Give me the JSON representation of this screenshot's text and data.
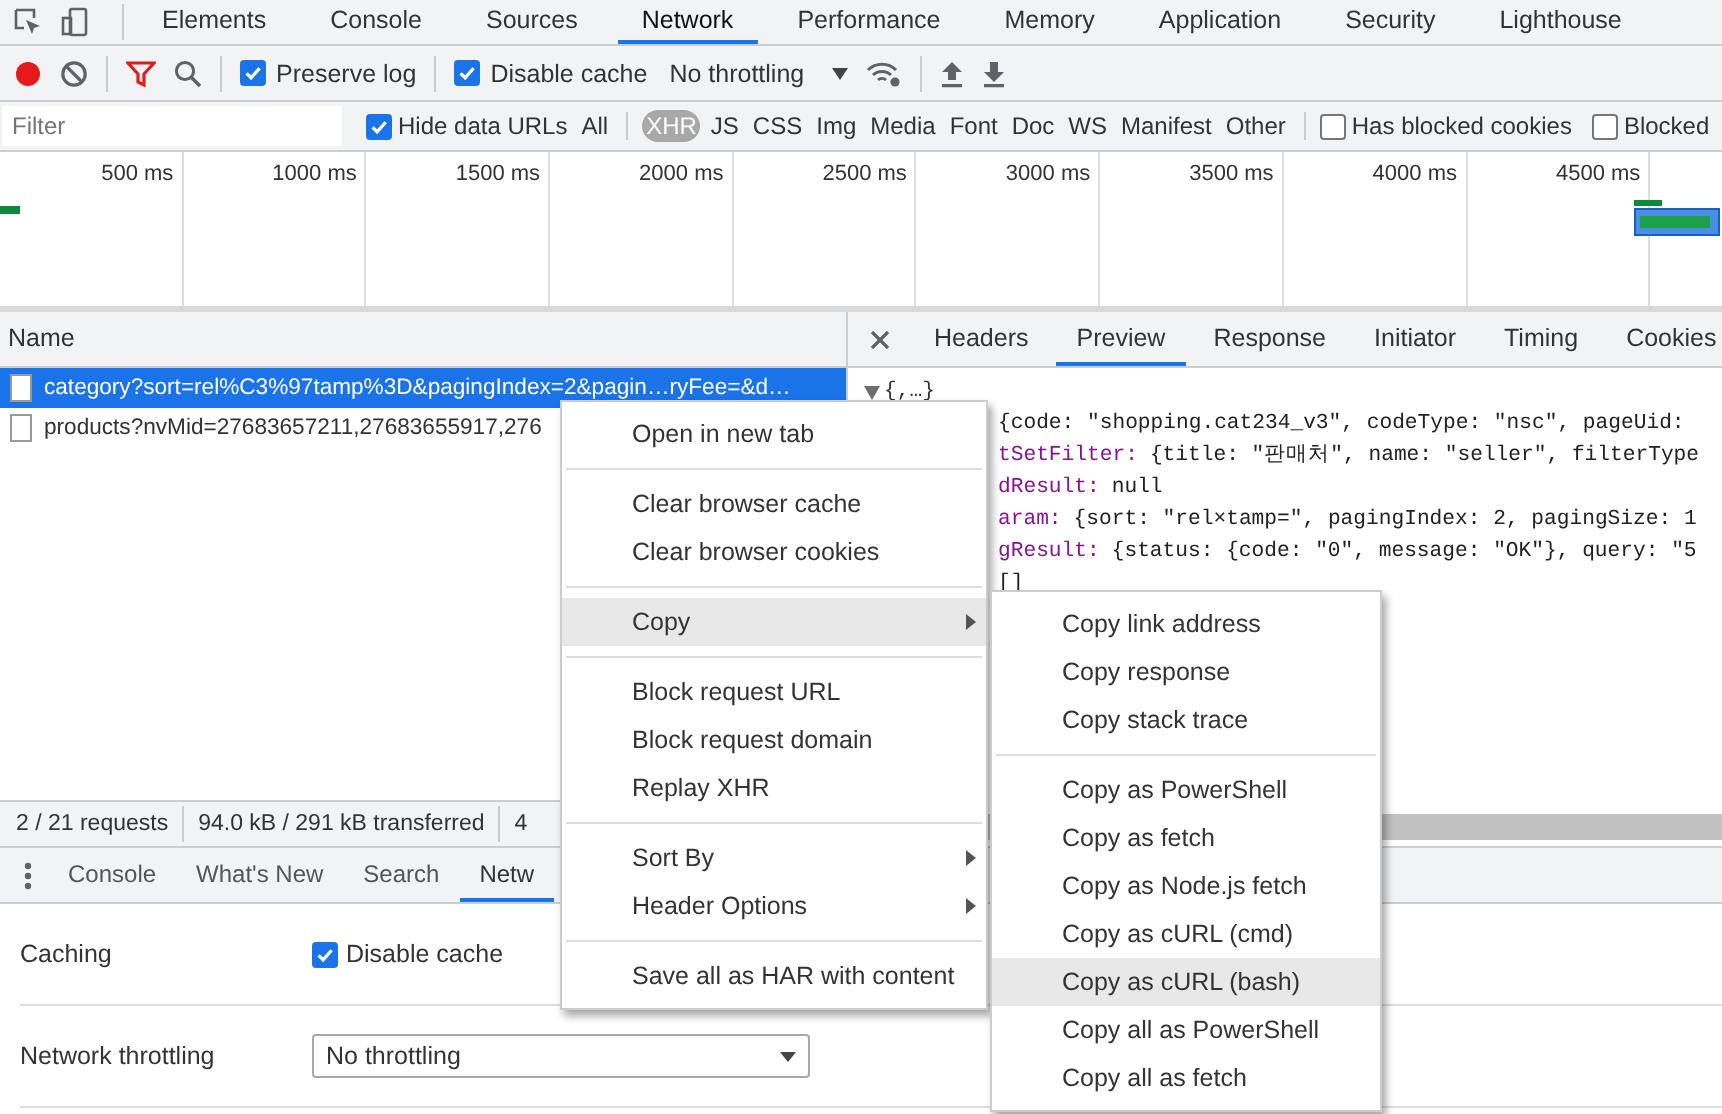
{
  "top_tabs": [
    {
      "label": "Elements",
      "selected": false
    },
    {
      "label": "Console",
      "selected": false
    },
    {
      "label": "Sources",
      "selected": false
    },
    {
      "label": "Network",
      "selected": true
    },
    {
      "label": "Performance",
      "selected": false
    },
    {
      "label": "Memory",
      "selected": false
    },
    {
      "label": "Application",
      "selected": false
    },
    {
      "label": "Security",
      "selected": false
    },
    {
      "label": "Lighthouse",
      "selected": false
    }
  ],
  "toolbar": {
    "recording": true,
    "filter_active": true,
    "preserve_log": {
      "label": "Preserve log",
      "checked": true
    },
    "disable_cache": {
      "label": "Disable cache",
      "checked": true
    },
    "throttling": "No throttling"
  },
  "filter_bar": {
    "placeholder": "Filter",
    "hide_data_urls": {
      "label": "Hide data URLs",
      "checked": true
    },
    "types": [
      {
        "label": "All",
        "selected": false
      },
      {
        "label": "XHR",
        "selected": true
      },
      {
        "label": "JS",
        "selected": false
      },
      {
        "label": "CSS",
        "selected": false
      },
      {
        "label": "Img",
        "selected": false
      },
      {
        "label": "Media",
        "selected": false
      },
      {
        "label": "Font",
        "selected": false
      },
      {
        "label": "Doc",
        "selected": false
      },
      {
        "label": "WS",
        "selected": false
      },
      {
        "label": "Manifest",
        "selected": false
      },
      {
        "label": "Other",
        "selected": false
      }
    ],
    "has_blocked_cookies": {
      "label": "Has blocked cookies",
      "checked": false
    },
    "blocked_requests": {
      "label": "Blocked",
      "checked": false
    }
  },
  "timeline": {
    "ticks": [
      "500 ms",
      "1000 ms",
      "1500 ms",
      "2000 ms",
      "2500 ms",
      "3000 ms",
      "3500 ms",
      "4000 ms",
      "4500 ms"
    ]
  },
  "requests": {
    "column": "Name",
    "rows": [
      {
        "name": "category?sort=rel%C3%97tamp%3D&pagingIndex=2&pagin…ryFee=&d…",
        "selected": true
      },
      {
        "name": "products?nvMid=27683657211,27683655917,276",
        "selected": false
      }
    ]
  },
  "details": {
    "tabs": [
      {
        "label": "Headers",
        "selected": false
      },
      {
        "label": "Preview",
        "selected": true
      },
      {
        "label": "Response",
        "selected": false
      },
      {
        "label": "Initiator",
        "selected": false
      },
      {
        "label": "Timing",
        "selected": false
      },
      {
        "label": "Cookies",
        "selected": false
      }
    ],
    "preview": {
      "root": "{,…}",
      "expanded": true,
      "lines": [
        {
          "value": "{code: \"shopping.cat234_v3\", codeType: \"nsc\", pageUid:"
        },
        {
          "key": "tSetFilter:",
          "value": "{title: \"판매처\", name: \"seller\", filterType"
        },
        {
          "key": "dResult:",
          "value": "null"
        },
        {
          "key": "aram:",
          "value": "{sort: \"rel×tamp=\", pagingIndex: 2, pagingSize: 1"
        },
        {
          "key": "gResult:",
          "value": "{status: {code: \"0\", message: \"OK\"}, query: \"5"
        },
        {
          "value": "[]"
        }
      ]
    }
  },
  "status_bar": [
    "2 / 21 requests",
    "94.0 kB / 291 kB transferred",
    "4"
  ],
  "drawer": {
    "tabs": [
      {
        "label": "Console",
        "selected": false
      },
      {
        "label": "What's New",
        "selected": false
      },
      {
        "label": "Search",
        "selected": false
      },
      {
        "label": "Netw",
        "selected": true
      }
    ],
    "settings": [
      {
        "kind": "checkbox",
        "label": "Caching",
        "option": "Disable cache",
        "checked": true
      },
      {
        "kind": "select",
        "label": "Network throttling",
        "value": "No throttling"
      }
    ]
  },
  "context_menu": {
    "groups": [
      [
        {
          "label": "Open in new tab",
          "has_submenu": false,
          "selected": false
        }
      ],
      [
        {
          "label": "Clear browser cache",
          "has_submenu": false,
          "selected": false
        },
        {
          "label": "Clear browser cookies",
          "has_submenu": false,
          "selected": false
        }
      ],
      [
        {
          "label": "Copy",
          "has_submenu": true,
          "selected": true
        }
      ],
      [
        {
          "label": "Block request URL",
          "has_submenu": false,
          "selected": false
        },
        {
          "label": "Block request domain",
          "has_submenu": false,
          "selected": false
        },
        {
          "label": "Replay XHR",
          "has_submenu": false,
          "selected": false
        }
      ],
      [
        {
          "label": "Sort By",
          "has_submenu": true,
          "selected": false
        },
        {
          "label": "Header Options",
          "has_submenu": true,
          "selected": false
        }
      ],
      [
        {
          "label": "Save all as HAR with content",
          "has_submenu": false,
          "selected": false
        }
      ]
    ]
  },
  "submenu": {
    "groups": [
      [
        {
          "label": "Copy link address",
          "selected": false
        },
        {
          "label": "Copy response",
          "selected": false
        },
        {
          "label": "Copy stack trace",
          "selected": false
        }
      ],
      [
        {
          "label": "Copy as PowerShell",
          "selected": false
        },
        {
          "label": "Copy as fetch",
          "selected": false
        },
        {
          "label": "Copy as Node.js fetch",
          "selected": false
        },
        {
          "label": "Copy as cURL (cmd)",
          "selected": false
        },
        {
          "label": "Copy as cURL (bash)",
          "selected": true
        },
        {
          "label": "Copy all as PowerShell",
          "selected": false
        },
        {
          "label": "Copy all as fetch",
          "selected": false
        }
      ]
    ]
  }
}
